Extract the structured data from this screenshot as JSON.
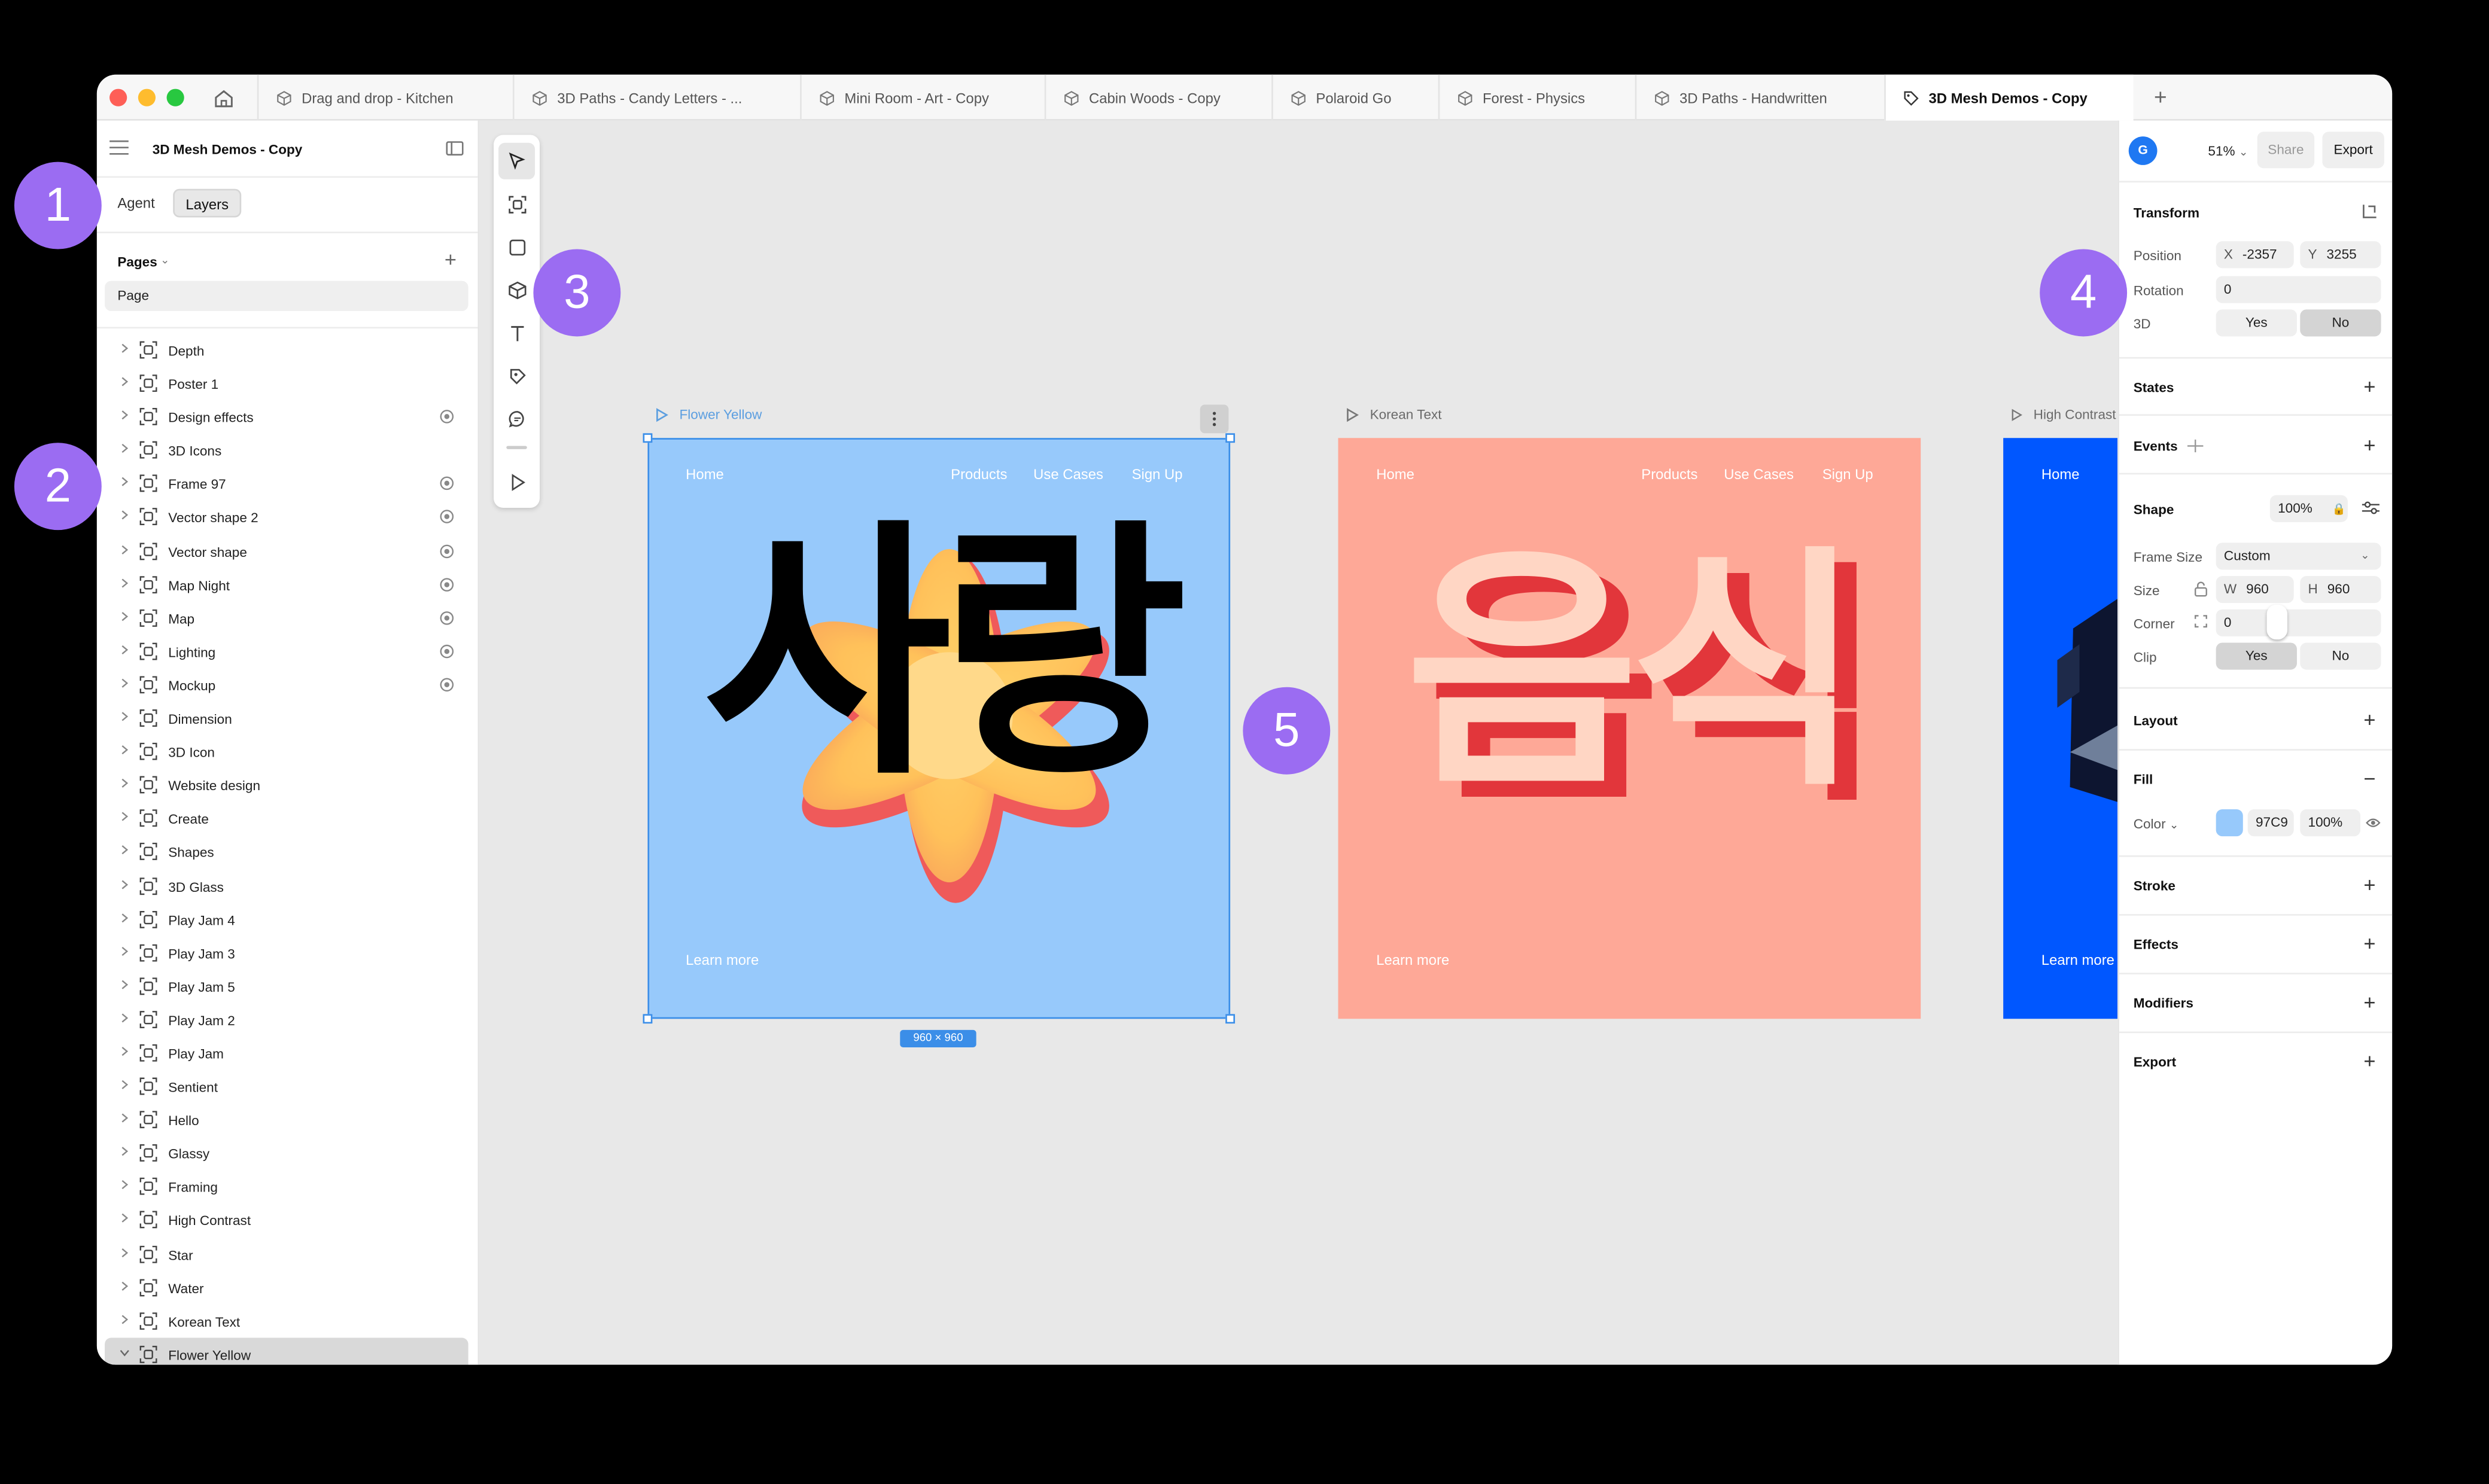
{
  "window": {
    "tabs": [
      {
        "label": "Drag and drop - Kitchen",
        "active": false
      },
      {
        "label": "3D Paths - Candy Letters - ...",
        "active": false
      },
      {
        "label": "Mini Room - Art - Copy",
        "active": false
      },
      {
        "label": "Cabin Woods - Copy",
        "active": false
      },
      {
        "label": "Polaroid Go",
        "active": false
      },
      {
        "label": "Forest - Physics",
        "active": false
      },
      {
        "label": "3D Paths - Handwritten",
        "active": false
      },
      {
        "label": "3D Mesh Demos - Copy",
        "active": true
      }
    ],
    "new_tab_label": "+"
  },
  "sidebar": {
    "project_title": "3D Mesh Demos - Copy",
    "mode_tabs": {
      "agent": "Agent",
      "layers": "Layers"
    },
    "pages_label": "Pages",
    "pages": [
      "Page"
    ],
    "layers": [
      {
        "name": "Depth",
        "visible_icon": false
      },
      {
        "name": "Poster 1",
        "visible_icon": false
      },
      {
        "name": "Design effects",
        "visible_icon": true
      },
      {
        "name": "3D Icons",
        "visible_icon": false
      },
      {
        "name": "Frame 97",
        "visible_icon": true
      },
      {
        "name": "Vector shape 2",
        "visible_icon": true
      },
      {
        "name": "Vector shape",
        "visible_icon": true
      },
      {
        "name": "Map Night",
        "visible_icon": true
      },
      {
        "name": "Map",
        "visible_icon": true
      },
      {
        "name": "Lighting",
        "visible_icon": true
      },
      {
        "name": "Mockup",
        "visible_icon": true
      },
      {
        "name": "Dimension",
        "visible_icon": false
      },
      {
        "name": "3D Icon",
        "visible_icon": false
      },
      {
        "name": "Website design",
        "visible_icon": false
      },
      {
        "name": "Create",
        "visible_icon": false
      },
      {
        "name": "Shapes",
        "visible_icon": false
      },
      {
        "name": "3D Glass",
        "visible_icon": false
      },
      {
        "name": "Play Jam 4",
        "visible_icon": false
      },
      {
        "name": "Play Jam 3",
        "visible_icon": false
      },
      {
        "name": "Play Jam 5",
        "visible_icon": false
      },
      {
        "name": "Play Jam 2",
        "visible_icon": false
      },
      {
        "name": "Play Jam",
        "visible_icon": false
      },
      {
        "name": "Sentient",
        "visible_icon": false
      },
      {
        "name": "Hello",
        "visible_icon": false
      },
      {
        "name": "Glassy",
        "visible_icon": false
      },
      {
        "name": "Framing",
        "visible_icon": false
      },
      {
        "name": "High Contrast",
        "visible_icon": false
      },
      {
        "name": "Star",
        "visible_icon": false
      },
      {
        "name": "Water",
        "visible_icon": false
      },
      {
        "name": "Korean Text",
        "visible_icon": false
      },
      {
        "name": "Flower Yellow",
        "visible_icon": false,
        "selected": true
      }
    ]
  },
  "toolbar": {
    "tools": [
      "select-tool",
      "frame-tool",
      "rectangle-tool",
      "3d-shape-tool",
      "text-tool",
      "pen-tool",
      "comment-tool",
      "preview-tool"
    ]
  },
  "canvas": {
    "frames": [
      {
        "label": "Flower Yellow",
        "bg": "#97c9fb",
        "nav": {
          "home": "Home",
          "products": "Products",
          "use_cases": "Use Cases",
          "sign_up": "Sign Up"
        },
        "headline": "사랑",
        "cta": "Learn more"
      },
      {
        "label": "Korean Text",
        "bg": "#fea897",
        "nav": {
          "home": "Home",
          "products": "Products",
          "use_cases": "Use Cases",
          "sign_up": "Sign Up"
        },
        "headline": "음식",
        "cta": "Learn more"
      },
      {
        "label": "High Contrast",
        "bg": "#0057ff",
        "nav": {
          "home": "Home"
        },
        "cta": "Learn more"
      }
    ],
    "selection_size": "960 × 960"
  },
  "inspector": {
    "avatar_letter": "G",
    "zoom": "51%",
    "share_label": "Share",
    "export_label": "Export",
    "transform": {
      "title": "Transform",
      "position_label": "Position",
      "x_label": "X",
      "x": "-2357",
      "y_label": "Y",
      "y": "3255",
      "rotation_label": "Rotation",
      "rotation": "0",
      "three_d_label": "3D",
      "yes": "Yes",
      "no": "No"
    },
    "states_title": "States",
    "events_title": "Events",
    "shape": {
      "title": "Shape",
      "opacity": "100%",
      "frame_size_label": "Frame Size",
      "frame_size": "Custom",
      "size_label": "Size",
      "w_label": "W",
      "w": "960",
      "h_label": "H",
      "h": "960",
      "corner_label": "Corner",
      "corner": "0",
      "clip_label": "Clip",
      "yes": "Yes",
      "no": "No"
    },
    "layout_title": "Layout",
    "fill": {
      "title": "Fill",
      "color_label": "Color",
      "color_swatch": "#97c9fb",
      "hex": "97C9",
      "opacity": "100%"
    },
    "stroke_title": "Stroke",
    "effects_title": "Effects",
    "modifiers_title": "Modifiers",
    "export_title": "Export"
  },
  "annotations": [
    "1",
    "2",
    "3",
    "4",
    "5"
  ],
  "colors": {
    "accent": "#3b8ee8",
    "badge": "#9b6cf2"
  }
}
